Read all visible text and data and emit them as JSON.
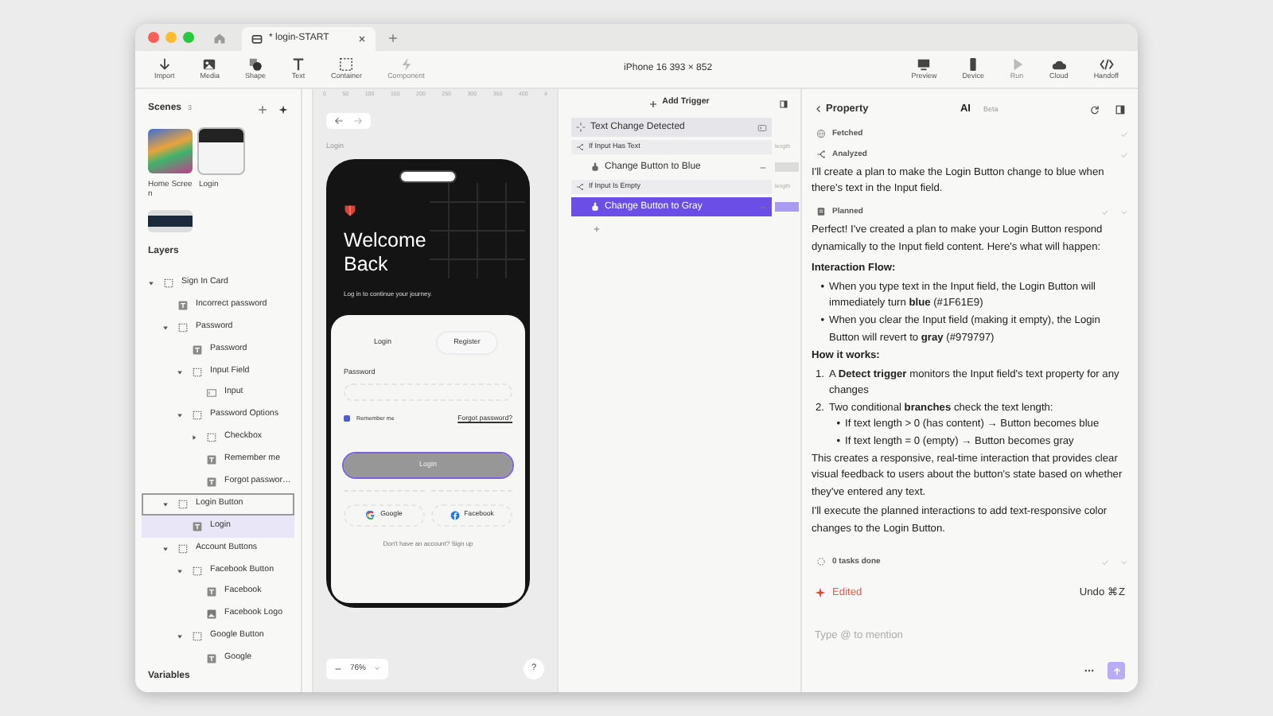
{
  "window": {
    "tabs": [
      {
        "label": "* login-START",
        "selected": true
      }
    ]
  },
  "toolbar": {
    "tools": [
      {
        "label": "Import",
        "disabled": false
      },
      {
        "label": "Media",
        "disabled": false
      },
      {
        "label": "Shape",
        "disabled": false
      },
      {
        "label": "Text",
        "disabled": false
      },
      {
        "label": "Container",
        "disabled": false
      },
      {
        "label": "Component",
        "disabled": true
      }
    ],
    "device": "iPhone 16  393 × 852",
    "actions": [
      {
        "label": "Preview",
        "disabled": false
      },
      {
        "label": "Device",
        "disabled": false
      },
      {
        "label": "Run",
        "disabled": true
      },
      {
        "label": "Cloud",
        "disabled": false
      },
      {
        "label": "Handoff",
        "disabled": false
      }
    ]
  },
  "scenes": {
    "title": "Scenes",
    "count": "3",
    "items": [
      {
        "label": "Home Screen",
        "selected": false
      },
      {
        "label": "Login",
        "selected": true
      },
      {
        "selected": false
      }
    ]
  },
  "layers": {
    "title": "Layers",
    "items": [
      {
        "label": "Sign In Card",
        "kind": "group",
        "expanded": true,
        "selected": false,
        "hovered": false,
        "children": [
          {
            "label": "Incorrect password",
            "kind": "text",
            "selected": false,
            "hovered": false
          },
          {
            "label": "Password",
            "kind": "group",
            "expanded": true,
            "selected": false,
            "hovered": false,
            "children": [
              {
                "label": "Password",
                "kind": "text",
                "selected": false,
                "hovered": false
              },
              {
                "label": "Input Field",
                "kind": "group",
                "expanded": true,
                "selected": false,
                "hovered": false,
                "children": [
                  {
                    "label": "Input",
                    "kind": "input",
                    "selected": false,
                    "hovered": false
                  }
                ]
              },
              {
                "label": "Password Options",
                "kind": "group",
                "expanded": true,
                "selected": false,
                "hovered": false,
                "children": [
                  {
                    "label": "Checkbox",
                    "kind": "group",
                    "expanded": false,
                    "selected": false,
                    "hovered": false
                  },
                  {
                    "label": "Remember me",
                    "kind": "text",
                    "selected": false,
                    "hovered": false
                  },
                  {
                    "label": "Forgot passwor…",
                    "kind": "text",
                    "selected": false,
                    "hovered": false
                  }
                ]
              }
            ]
          },
          {
            "label": "Login Button",
            "kind": "group",
            "expanded": true,
            "selected": true,
            "hovered": false,
            "children": [
              {
                "label": "Login",
                "kind": "text",
                "selected": false,
                "hovered": true
              }
            ]
          },
          {
            "label": "Account Buttons",
            "kind": "group",
            "expanded": true,
            "selected": false,
            "hovered": false,
            "children": [
              {
                "label": "Facebook Button",
                "kind": "group",
                "expanded": true,
                "selected": false,
                "hovered": false,
                "children": [
                  {
                    "label": "Facebook",
                    "kind": "text",
                    "selected": false,
                    "hovered": false
                  },
                  {
                    "label": "Facebook Logo",
                    "kind": "image",
                    "selected": false,
                    "hovered": false
                  }
                ]
              },
              {
                "label": "Google Button",
                "kind": "group",
                "expanded": true,
                "selected": false,
                "hovered": false,
                "children": [
                  {
                    "label": "Google",
                    "kind": "text",
                    "selected": false,
                    "hovered": false
                  }
                ]
              }
            ]
          }
        ]
      }
    ]
  },
  "variables": "Variables",
  "canvas": {
    "ruler": [
      "0",
      "50",
      "100",
      "150",
      "200",
      "250",
      "300",
      "350",
      "400",
      "4"
    ],
    "frame_label": "Login",
    "zoom": "76%",
    "help": "?"
  },
  "screen": {
    "title": "Welcome Back",
    "subtitle": "Log in to continue your journey.",
    "tabs": [
      {
        "label": "Login",
        "selected": false
      },
      {
        "label": "Register",
        "selected": true
      }
    ],
    "password_label": "Password",
    "remember": {
      "label": "Remember me",
      "checked": true
    },
    "forgot": "Forgot password?",
    "login_button": {
      "label": "Login",
      "selected": true
    },
    "social": [
      {
        "kind": "google",
        "label": "Google"
      },
      {
        "kind": "facebook",
        "label": "Facebook"
      }
    ],
    "signup": {
      "text": "Don't have an account?",
      "link": "Sign up"
    }
  },
  "triggers": {
    "add": "Add Trigger",
    "items": [
      {
        "kind": "trigger",
        "label": "Text Change Detected"
      },
      {
        "kind": "condition",
        "label": "If Input Has Text",
        "side_text": "length"
      },
      {
        "kind": "action",
        "label": "Change Button to Blue",
        "selected": false
      },
      {
        "kind": "condition",
        "label": "If Input Is Empty",
        "side_text": "length"
      },
      {
        "kind": "action",
        "label": "Change Button to Gray",
        "selected": true
      }
    ]
  },
  "assistant": {
    "back": "Property",
    "tab": "AI",
    "badge": "Beta",
    "chat": [
      {
        "kind": "step",
        "label": "Fetched",
        "expandable": false
      },
      {
        "kind": "step",
        "label": "Analyzed",
        "expandable": false
      },
      {
        "kind": "paragraph",
        "text": "I'll create a plan to make the Login Button change to blue when there's text in the Input field."
      },
      {
        "kind": "step",
        "label": "Planned",
        "expandable": true
      },
      {
        "kind": "paragraph",
        "text": "Perfect! I've created a plan to make your Login Button respond dynamically to the Input field content. Here's what will happen:"
      },
      {
        "kind": "heading",
        "text": "Interaction Flow:"
      },
      {
        "kind": "bullets",
        "items": [
          {
            "marker": "•",
            "text": "When you type text in the Input field, the Login Button will immediately turn **blue** (#1F61E9)"
          },
          {
            "marker": "•",
            "text": "When you clear the Input field (making it empty), the Login Button will revert to **gray** (#979797)"
          }
        ]
      },
      {
        "kind": "heading",
        "text": "How it works:"
      },
      {
        "kind": "numbered",
        "items": [
          {
            "marker": "1.",
            "text": "A **Detect trigger** monitors the Input field's text property for any changes"
          },
          {
            "marker": "2.",
            "text": "Two conditional **branches** check the text length:",
            "children": [
              {
                "marker": "•",
                "text": "If text length > 0 (has content) → Button becomes blue"
              },
              {
                "marker": "•",
                "text": "If text length = 0 (empty) → Button becomes gray"
              }
            ]
          }
        ]
      },
      {
        "kind": "paragraph",
        "text": "This creates a responsive, real-time interaction that provides clear visual feedback to users about the button's state based on whether they've entered any text."
      },
      {
        "kind": "paragraph",
        "text": "I'll execute the planned interactions to add text-responsive color changes to the Login Button."
      },
      {
        "kind": "step",
        "label": "0 tasks done",
        "expandable": true
      }
    ],
    "edited": "Edited",
    "undo": "Undo ⌘Z",
    "placeholder": "Type @ to mention"
  }
}
